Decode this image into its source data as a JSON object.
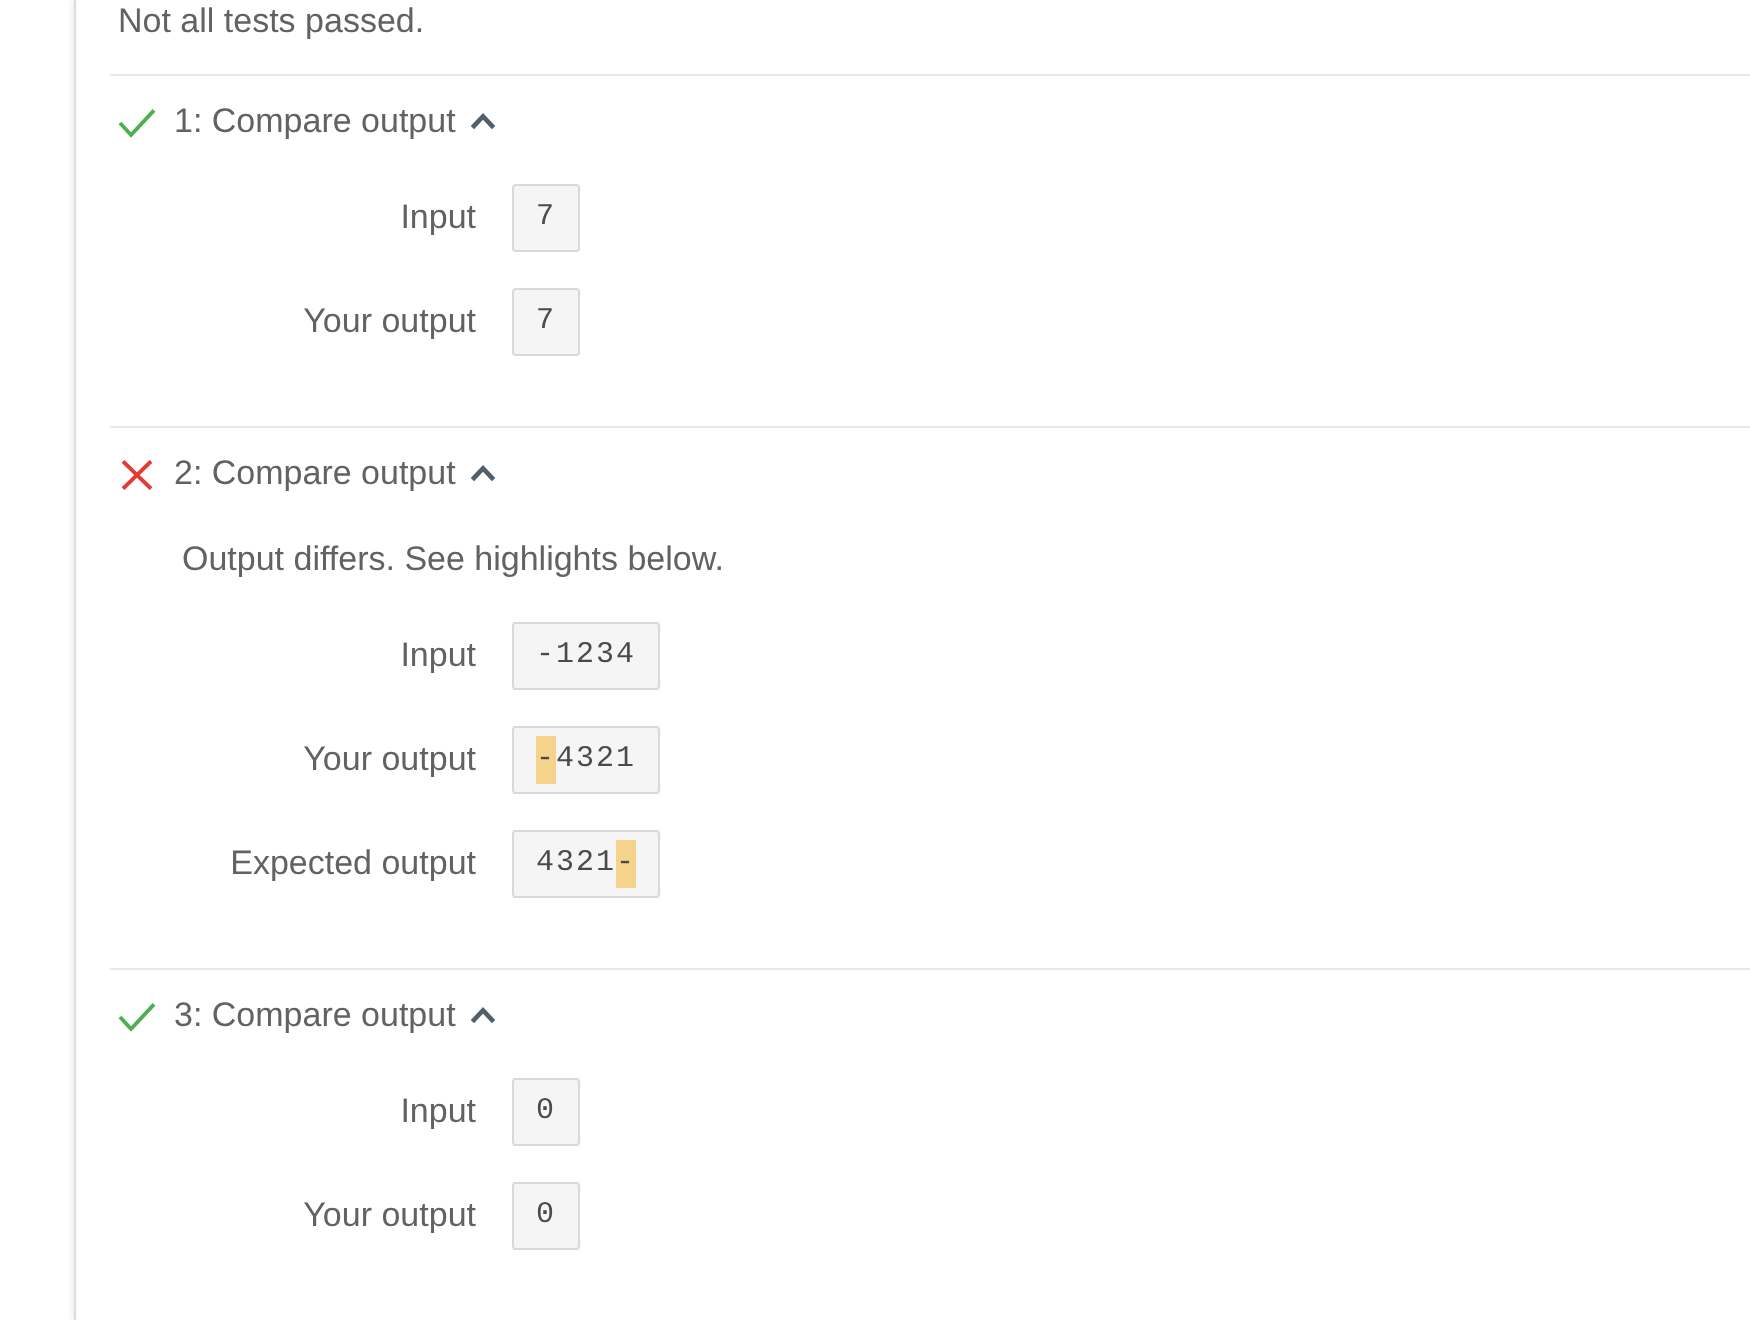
{
  "summary": "Not all tests passed.",
  "tests": [
    {
      "title": "1: Compare output",
      "passed": true,
      "expanded": true,
      "rows": [
        {
          "label": "Input",
          "segments": [
            {
              "text": "7",
              "highlighted": false
            }
          ]
        },
        {
          "label": "Your output",
          "segments": [
            {
              "text": "7",
              "highlighted": false
            }
          ]
        }
      ]
    },
    {
      "title": "2: Compare output",
      "passed": false,
      "expanded": true,
      "message": "Output differs. See highlights below.",
      "rows": [
        {
          "label": "Input",
          "segments": [
            {
              "text": "-1234",
              "highlighted": false
            }
          ]
        },
        {
          "label": "Your output",
          "segments": [
            {
              "text": "-",
              "highlighted": true
            },
            {
              "text": "4321",
              "highlighted": false
            }
          ]
        },
        {
          "label": "Expected output",
          "segments": [
            {
              "text": "4321",
              "highlighted": false
            },
            {
              "text": "-",
              "highlighted": true
            }
          ]
        }
      ]
    },
    {
      "title": "3: Compare output",
      "passed": true,
      "expanded": true,
      "rows": [
        {
          "label": "Input",
          "segments": [
            {
              "text": "0",
              "highlighted": false
            }
          ]
        },
        {
          "label": "Your output",
          "segments": [
            {
              "text": "0",
              "highlighted": false
            }
          ]
        }
      ]
    }
  ]
}
